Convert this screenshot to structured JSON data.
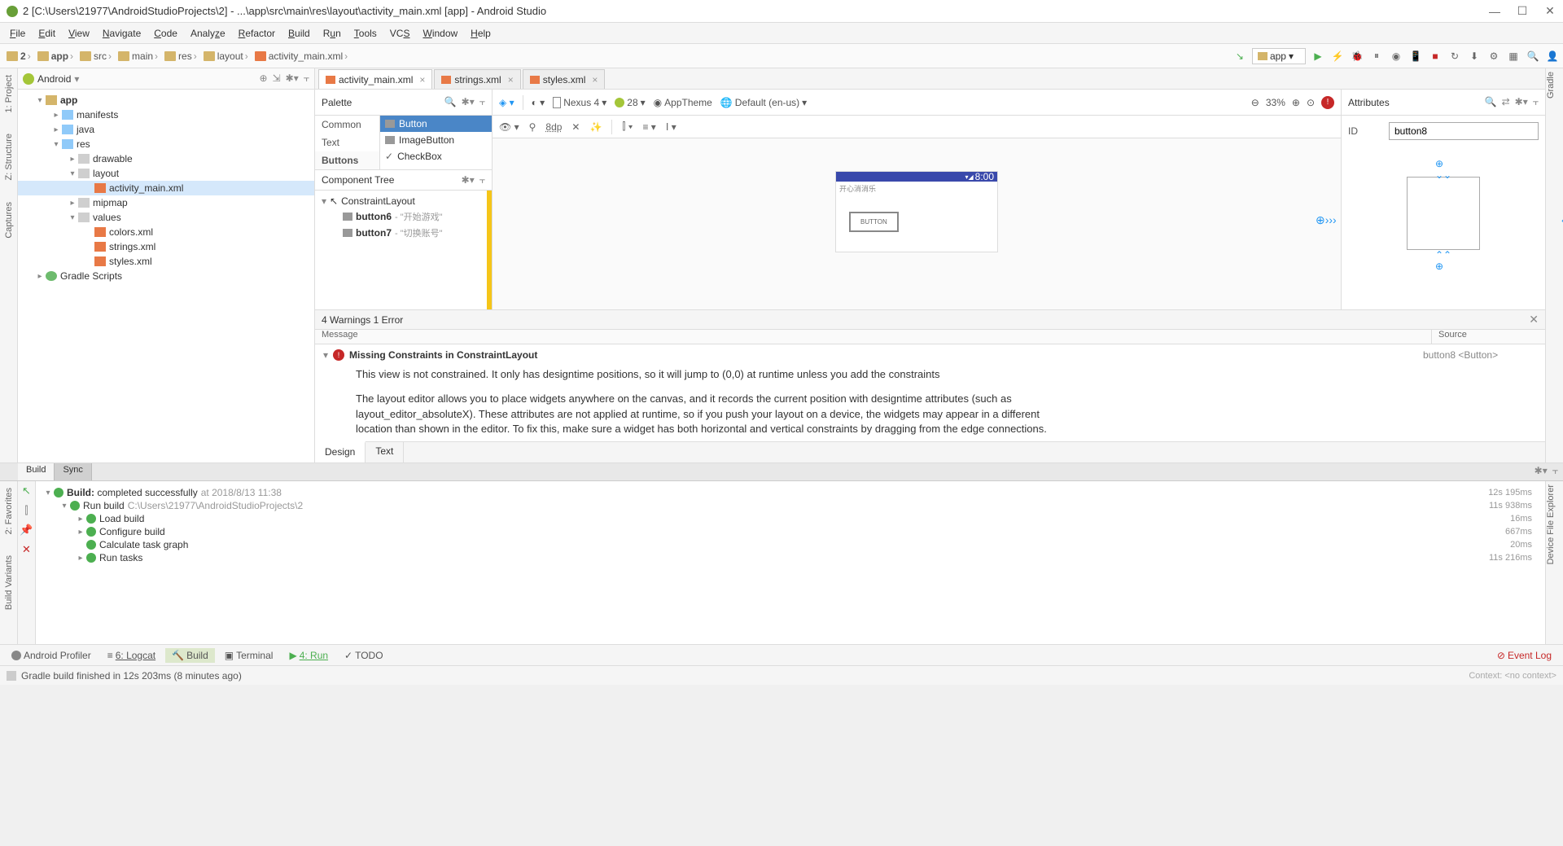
{
  "title": "2 [C:\\Users\\21977\\AndroidStudioProjects\\2] - ...\\app\\src\\main\\res\\layout\\activity_main.xml [app] - Android Studio",
  "menus": [
    "File",
    "Edit",
    "View",
    "Navigate",
    "Code",
    "Analyze",
    "Refactor",
    "Build",
    "Run",
    "Tools",
    "VCS",
    "Window",
    "Help"
  ],
  "breadcrumbs": [
    "2",
    "app",
    "src",
    "main",
    "res",
    "layout",
    "activity_main.xml"
  ],
  "app_selector": "app",
  "project_header": "Android",
  "tree": {
    "app": "app",
    "manifests": "manifests",
    "java": "java",
    "res": "res",
    "drawable": "drawable",
    "layout": "layout",
    "activity_main": "activity_main.xml",
    "mipmap": "mipmap",
    "values": "values",
    "colors": "colors.xml",
    "strings": "strings.xml",
    "styles": "styles.xml",
    "gradle": "Gradle Scripts"
  },
  "gutter": {
    "project": "1: Project",
    "structure": "Z: Structure",
    "captures": "Captures",
    "fav": "2: Favorites",
    "bv": "Build Variants",
    "gradle": "Gradle",
    "dfe": "Device File Explorer"
  },
  "editor_tabs": [
    {
      "label": "activity_main.xml",
      "active": true
    },
    {
      "label": "strings.xml",
      "active": false
    },
    {
      "label": "styles.xml",
      "active": false
    }
  ],
  "palette": {
    "label": "Palette",
    "cats": [
      "Common",
      "Text",
      "Buttons"
    ],
    "widgets": [
      "Button",
      "ImageButton",
      "CheckBox"
    ]
  },
  "component_tree": {
    "label": "Component Tree",
    "root": "ConstraintLayout",
    "btn6": "button6",
    "btn6sub": "- \"开始游戏\"",
    "btn7": "button7",
    "btn7sub": "- \"切换账号\""
  },
  "canvas_toolbar": {
    "device": "Nexus 4",
    "api": "28",
    "theme": "AppTheme",
    "locale": "Default (en-us)",
    "zoom": "33%"
  },
  "canvas_toolbar2": {
    "dp": "8dp"
  },
  "phone": {
    "time": "8:00",
    "title_cn": "开心消消乐",
    "btn": "BUTTON"
  },
  "attributes": {
    "label": "Attributes",
    "id_label": "ID",
    "id_value": "button8"
  },
  "design_tabs": {
    "design": "Design",
    "text": "Text"
  },
  "issues": {
    "head": "4 Warnings 1 Error",
    "col_msg": "Message",
    "col_src": "Source",
    "title": "Missing Constraints in ConstraintLayout",
    "source": "button8 <Button>",
    "p1": "This view is not constrained. It only has designtime positions, so it will jump to (0,0) at runtime unless you add the constraints",
    "p2": "The layout editor allows you to place widgets anywhere on the canvas, and it records the current position with designtime attributes (such as layout_editor_absoluteX). These attributes are not applied at runtime, so if you push your layout on a device, the widgets may appear in a different location than shown in the editor. To fix this, make sure a widget has both horizontal and vertical constraints by dragging from the edge connections."
  },
  "build": {
    "tabs": [
      "Build",
      "Sync"
    ],
    "root": "Build:",
    "root_status": "completed successfully",
    "root_time": "at 2018/8/13 11:38",
    "root_dur": "12s 195ms",
    "run": "Run build",
    "run_path": "C:\\Users\\21977\\AndroidStudioProjects\\2",
    "run_dur": "11s 938ms",
    "load": "Load build",
    "load_dur": "16ms",
    "conf": "Configure build",
    "conf_dur": "667ms",
    "calc": "Calculate task graph",
    "calc_dur": "20ms",
    "tasks": "Run tasks",
    "tasks_dur": "11s 216ms"
  },
  "bottom_buttons": {
    "profiler": "Android Profiler",
    "logcat": "6: Logcat",
    "build": "Build",
    "terminal": "Terminal",
    "run": "4: Run",
    "todo": "TODO",
    "eventlog": "Event Log"
  },
  "statusbar": {
    "msg": "Gradle build finished in 12s 203ms (8 minutes ago)",
    "ctx": "Context: <no context>"
  }
}
